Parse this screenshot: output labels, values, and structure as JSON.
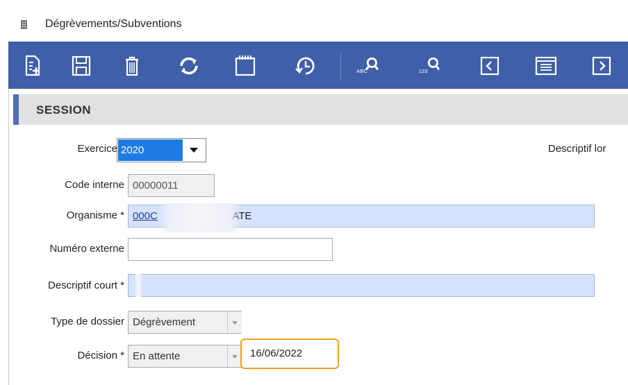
{
  "window": {
    "title": "Dégrèvements/Subventions",
    "icon": "document-icon"
  },
  "toolbar": {
    "buttons": [
      {
        "name": "new-record-button",
        "icon": "new-document-icon"
      },
      {
        "name": "save-button",
        "icon": "save-icon"
      },
      {
        "name": "delete-button",
        "icon": "trash-icon"
      },
      {
        "name": "refresh-button",
        "icon": "refresh-icon"
      },
      {
        "name": "calendar-button",
        "icon": "calendar-icon"
      },
      {
        "name": "history-button",
        "icon": "history-icon"
      },
      {
        "name": "search-abc-button",
        "icon": "search-abc-icon",
        "label": "ABC"
      },
      {
        "name": "search-123-button",
        "icon": "search-123-icon",
        "label": "123"
      },
      {
        "name": "previous-button",
        "icon": "chevron-left-icon"
      },
      {
        "name": "list-button",
        "icon": "list-icon"
      },
      {
        "name": "next-button",
        "icon": "chevron-right-icon"
      }
    ],
    "accent_color": "#3f5fa8"
  },
  "section": {
    "title": "SESSION",
    "accent_color": "#4f6fb5"
  },
  "form": {
    "exercice": {
      "label": "Exercice *",
      "value": "2020"
    },
    "descriptif_long": {
      "label": "Descriptif lor"
    },
    "code_interne": {
      "label": "Code interne",
      "value": "00000011"
    },
    "organisme": {
      "label": "Organisme *",
      "value_start": "000C",
      "value_end": "ATE"
    },
    "numero_externe": {
      "label": "Numéro externe",
      "value": ""
    },
    "descriptif_court": {
      "label": "Descriptif court *",
      "value": ""
    },
    "type_dossier": {
      "label": "Type de dossier",
      "value": "Dégrèvement"
    },
    "decision": {
      "label": "Décision *",
      "value": "En attente",
      "date": "16/06/2022"
    }
  },
  "colors": {
    "required_field": "#d6e2ff",
    "readonly_field": "#f0f0f0",
    "highlight": "#f0a020",
    "selection": "#1e7be3"
  }
}
